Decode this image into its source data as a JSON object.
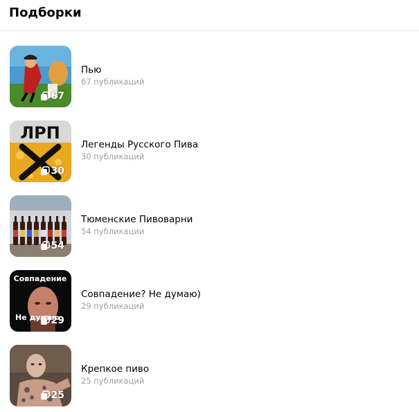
{
  "header": {
    "title": "Подборки"
  },
  "collections": [
    {
      "name": "Пью",
      "subtitle": "67 публикаций",
      "count": "67",
      "image": "cartoon-drinker"
    },
    {
      "name": "Легенды Русского Пива",
      "subtitle": "30 публикаций",
      "count": "30",
      "image": "lrp-logo",
      "image_text": "ЛРП"
    },
    {
      "name": "Тюменские Пивоварни",
      "subtitle": "54 публикации",
      "count": "54",
      "image": "beer-bottles"
    },
    {
      "name": "Совпадение? Не думаю)",
      "subtitle": "29 публикаций",
      "count": "29",
      "image": "meme-face",
      "image_text_top": "Совпадение",
      "image_text_bottom": "Не думаю"
    },
    {
      "name": "Крепкое пиво",
      "subtitle": "25 публикаций",
      "count": "25",
      "image": "tattooed-man"
    }
  ]
}
